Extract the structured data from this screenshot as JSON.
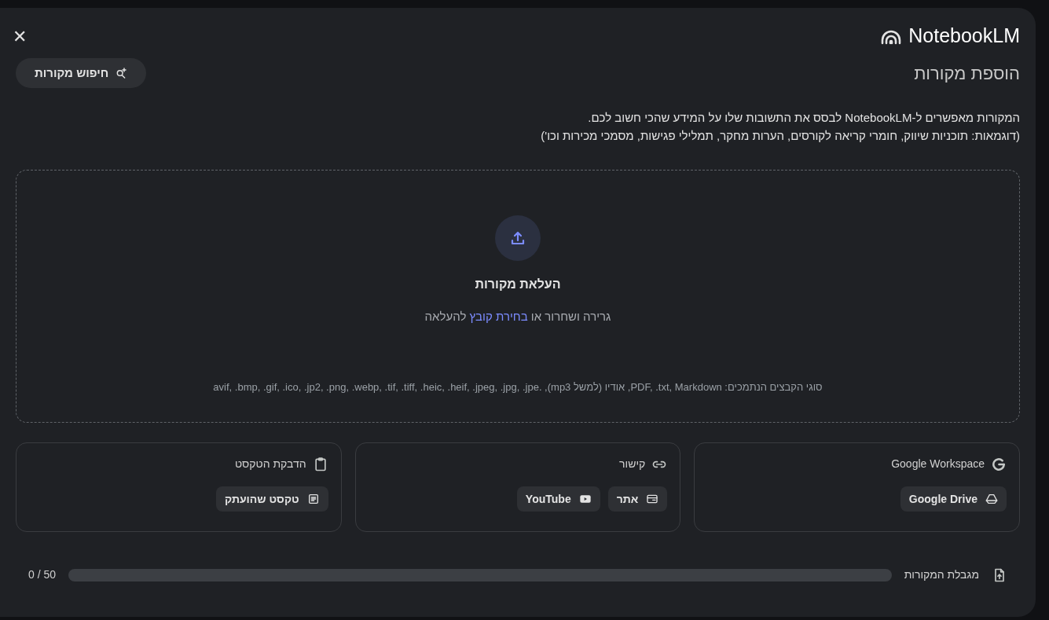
{
  "header": {
    "logo": "NotebookLM",
    "close": "✕"
  },
  "title": "הוספת מקורות",
  "search_button": {
    "label": "חיפוש מקורות"
  },
  "description": [
    "המקורות מאפשרים ל-NotebookLM לבסס את התשובות שלו על המידע שהכי חשוב לכם.",
    "(דוגמאות: תוכניות שיווק, חומרי קריאה לקורסים, הערות מחקר, תמלילי פגישות, מסמכי מכירות וכו')"
  ],
  "upload": {
    "title": "העלאת מקורות",
    "hint_before": "גרירה ושחרור או ",
    "hint_link": "בחירת קובץ",
    "hint_after": " להעלאה",
    "file_types": "סוגי הקבצים הנתמכים: PDF, .txt, Markdown, אודיו (למשל mp3), .avif, .bmp, .gif, .ico, .jp2, .png, .webp, .tif, .tiff, .heic, .heif, .jpeg, .jpg, .jpe"
  },
  "cards": [
    {
      "kind": "google",
      "title": "Google Workspace",
      "chips": [
        {
          "kind": "drive",
          "label": "Google Drive"
        }
      ]
    },
    {
      "kind": "link",
      "title": "קישור",
      "chips": [
        {
          "kind": "web",
          "label": "אתר"
        },
        {
          "kind": "youtube",
          "label": "YouTube"
        }
      ]
    },
    {
      "kind": "paste",
      "title": "הדבקת הטקסט",
      "chips": [
        {
          "kind": "text",
          "label": "טקסט שהועתק"
        }
      ]
    }
  ],
  "limit": {
    "label": "מגבלת המקורות",
    "level": 0,
    "count": "0 / 50"
  }
}
